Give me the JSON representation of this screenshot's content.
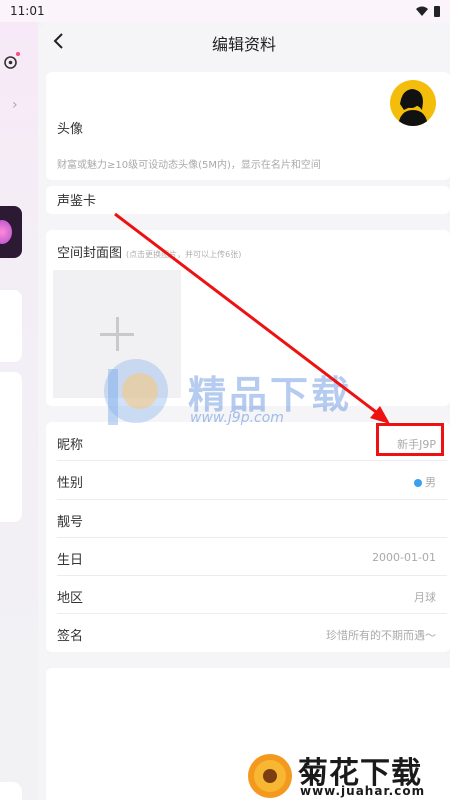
{
  "status": {
    "time": "11:01"
  },
  "header": {
    "title": "编辑资料",
    "back_icon": "chevron-left-icon"
  },
  "avatar_section": {
    "label": "头像",
    "hint": "财富或魅力≥10级可设动态头像(5M内)，显示在名片和空间"
  },
  "voice_card": {
    "label": "声鉴卡"
  },
  "cover_section": {
    "label": "空间封面图",
    "hint": "(点击更换图片，并可以上传6张)"
  },
  "profile_rows": [
    {
      "label": "昵称",
      "value": "新手J9P"
    },
    {
      "label": "性别",
      "value": "男"
    },
    {
      "label": "靓号",
      "value": ""
    },
    {
      "label": "生日",
      "value": "2000-01-01"
    },
    {
      "label": "地区",
      "value": "月球"
    },
    {
      "label": "签名",
      "value": "珍惜所有的不期而遇～"
    }
  ],
  "watermark": {
    "brand": "精品下载",
    "url": "www.j9p.com"
  },
  "bottom_watermark": {
    "brand": "菊花下载网",
    "url": "www.juahar.com"
  },
  "colors": {
    "accent_red": "#e11",
    "gender_blue": "#3aa0f0",
    "avatar_bg": "#f5bd0b"
  }
}
